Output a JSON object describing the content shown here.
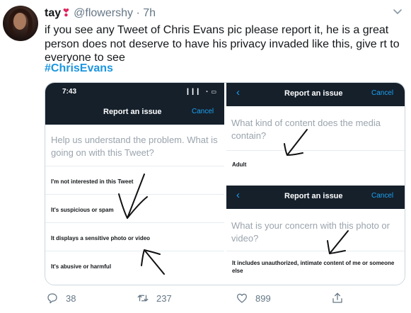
{
  "tweet": {
    "name": "tay",
    "heart": "❣",
    "handle": "@flowershy",
    "separator": "·",
    "time": "7h",
    "text": "if you see any Tweet of Chris Evans pic please report it, he is a great person does not deserve to have his privacy invaded like this, give rt to everyone to see",
    "hashtag": "#ChrisEvans"
  },
  "media": {
    "left_screen": {
      "status_time": "7:43",
      "status_icons": "▎▎▎ ◔ ▭",
      "nav_title": "Report an issue",
      "cancel": "Cancel",
      "question": "Help us understand the problem. What is going on with this Tweet?",
      "options": [
        "I'm not interested in this Tweet",
        "It's suspicious or spam",
        "It displays a sensitive photo or video",
        "It's abusive or harmful"
      ]
    },
    "right_top_screen": {
      "back": "‹",
      "nav_title": "Report an issue",
      "cancel": "Cancel",
      "question": "What kind of content does the media contain?",
      "option": "Adult"
    },
    "right_bottom_screen": {
      "back": "‹",
      "nav_title": "Report an issue",
      "cancel": "Cancel",
      "question": "What is your concern with this photo or video?",
      "option": "It includes unauthorized, intimate content of me or someone else"
    }
  },
  "actions": {
    "replies": "38",
    "retweets": "237",
    "likes": "899",
    "icons": [
      "reply-icon",
      "retweet-icon",
      "like-icon",
      "share-icon"
    ]
  },
  "colors": {
    "accent": "#1da1f2",
    "hashtag": "#1b95e0",
    "nav_bg": "#15202b",
    "muted": "#657786"
  }
}
